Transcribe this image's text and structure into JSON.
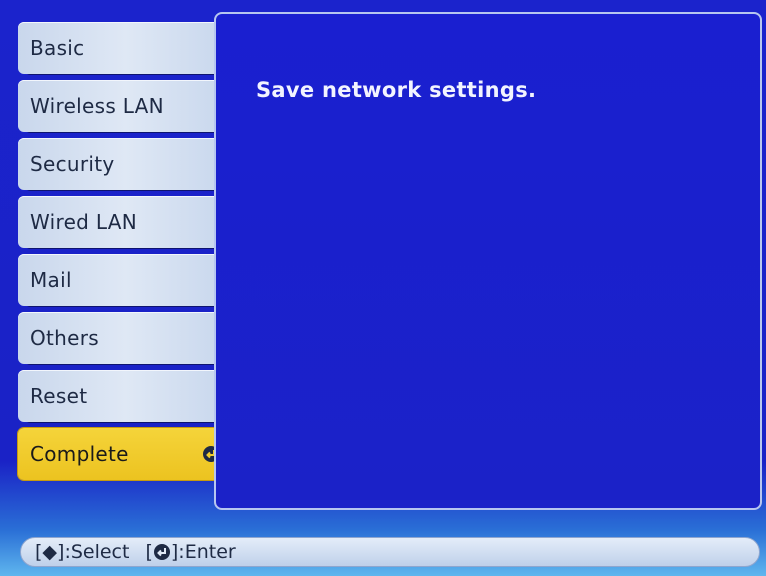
{
  "sidebar": {
    "items": [
      {
        "label": "Basic"
      },
      {
        "label": "Wireless LAN"
      },
      {
        "label": "Security"
      },
      {
        "label": "Wired LAN"
      },
      {
        "label": "Mail"
      },
      {
        "label": "Others"
      },
      {
        "label": "Reset"
      },
      {
        "label": "Complete"
      }
    ]
  },
  "main": {
    "message": "Save network settings."
  },
  "hintbar": {
    "select_key": "[◆]",
    "select_label": ":Select",
    "enter_key_open": "[",
    "enter_key_close": "]",
    "enter_label": ":Enter"
  },
  "colors": {
    "background": "#1a22c9",
    "tab": "#dfe8f5",
    "active_tab": "#f1cd2c",
    "text": "#1e2a44",
    "message": "#f2f4ff"
  },
  "icons": {
    "enter": "enter-icon",
    "updown": "up-down-arrow-icon"
  }
}
